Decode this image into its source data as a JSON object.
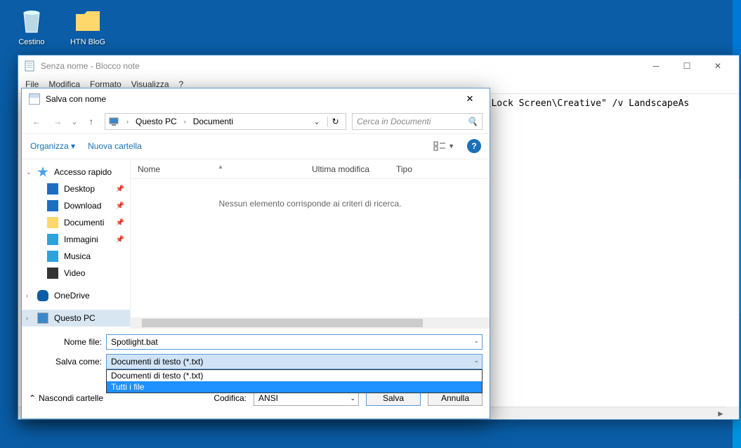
{
  "desktop": {
    "recycle_bin": "Cestino",
    "htn_blog": "HTN BloG"
  },
  "notepad": {
    "title": "Senza nome - Blocco note",
    "menu": {
      "file": "File",
      "modifica": "Modifica",
      "formato": "Formato",
      "visualizza": "Visualizza",
      "help": "?"
    },
    "content": "on\\Lock Screen\\Creative\" /v LandscapeAs"
  },
  "dialog": {
    "title": "Salva con nome",
    "breadcrumb": {
      "root": "Questo PC",
      "current": "Documenti"
    },
    "search_placeholder": "Cerca in Documenti",
    "toolbar": {
      "organize": "Organizza",
      "new_folder": "Nuova cartella"
    },
    "sidebar": {
      "quick_access": "Accesso rapido",
      "desktop": "Desktop",
      "download": "Download",
      "documenti": "Documenti",
      "immagini": "Immagini",
      "musica": "Musica",
      "video": "Video",
      "onedrive": "OneDrive",
      "questo_pc": "Questo PC"
    },
    "columns": {
      "name": "Nome",
      "modified": "Ultima modifica",
      "type": "Tipo"
    },
    "empty_msg": "Nessun elemento corrisponde ai criteri di ricerca.",
    "form": {
      "filename_label": "Nome file:",
      "filename_value": "Spotlight.bat",
      "saveas_label": "Salva come:",
      "saveas_value": "Documenti di testo (*.txt)",
      "dropdown_opt1": "Documenti di testo (*.txt)",
      "dropdown_opt2": "Tutti i file",
      "encoding_label": "Codifica:",
      "encoding_value": "ANSI",
      "hide_folders": "Nascondi cartelle",
      "save": "Salva",
      "cancel": "Annulla"
    }
  }
}
